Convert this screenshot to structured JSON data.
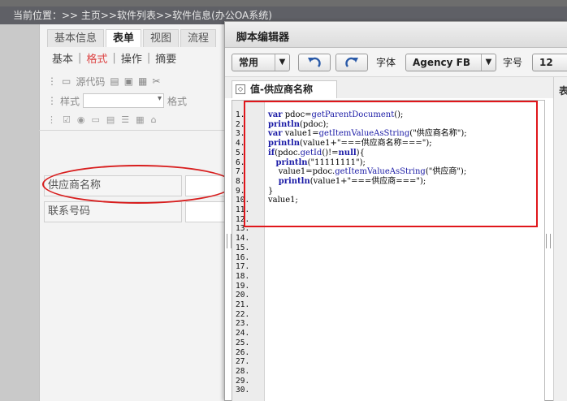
{
  "breadcrumb": "当前位置：>> 主页>>软件列表>>软件信息(办公OA系统)",
  "bg_tabs": [
    "基本信息",
    "表单",
    "视图",
    "流程"
  ],
  "bg_active_tab": "表单",
  "bg_subtabs": [
    "基本",
    "格式",
    "操作",
    "摘要"
  ],
  "bg_active_subtab": "格式",
  "bg_toolbar": {
    "source_code": "源代码",
    "style_label": "样式",
    "format_label": "格式"
  },
  "form_fields": [
    {
      "label": "供应商名称"
    },
    {
      "label": "联系号码"
    }
  ],
  "editor": {
    "title": "脚本编辑器",
    "toolbar": {
      "common_dropdown": "常用",
      "font_label": "字体",
      "font_value": "Agency FB",
      "size_label": "字号",
      "size_value": "12"
    },
    "tab_label": "值-供应商名称",
    "right_strip_char": "表",
    "line_numbers": [
      "1.",
      "2.",
      "3.",
      "4.",
      "5.",
      "6.",
      "7.",
      "8.",
      "9.",
      "10.",
      "11.",
      "12.",
      "13.",
      "14.",
      "15.",
      "16.",
      "17.",
      "18.",
      "19.",
      "20.",
      "21.",
      "22.",
      "23.",
      "24.",
      "25.",
      "26.",
      "27.",
      "28.",
      "29.",
      "30."
    ],
    "code_lines": [
      "var pdoc=getParentDocument();",
      "println(pdoc);",
      "var value1=getItemValueAsString(\"供应商名称\");",
      "println(value1+\"===供应商名称===\");",
      "if(pdoc.getId()!=null){",
      "   println(\"11111111\");",
      "    value1=pdoc.getItemValueAsString(\"供应商\");",
      "    println(value1+\"===供应商===\");",
      "}",
      "value1;",
      "",
      ""
    ]
  },
  "colors": {
    "highlight_red": "#e0161b",
    "keyword_blue": "#1a1aa6"
  }
}
